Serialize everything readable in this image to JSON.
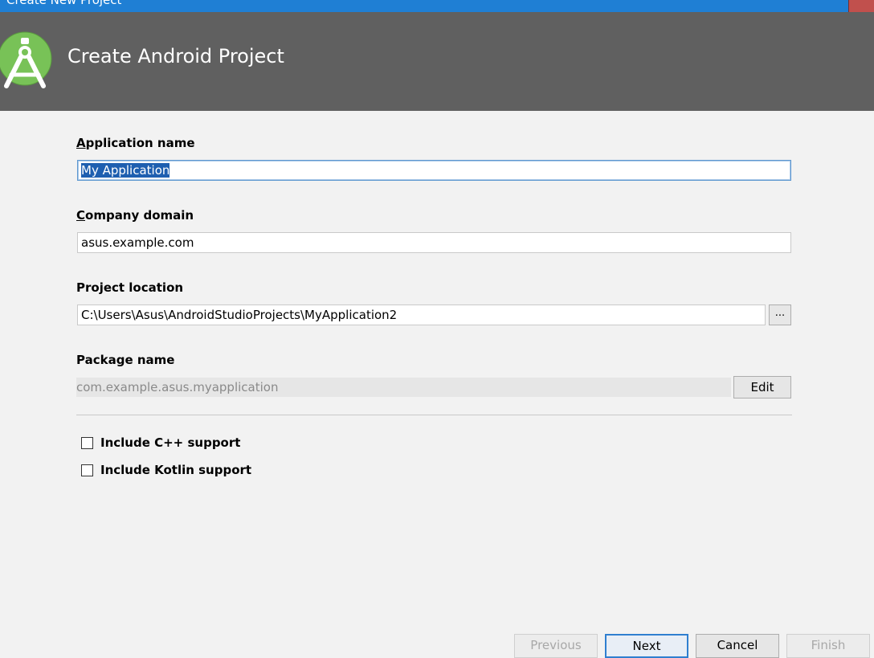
{
  "window": {
    "title": "Create New Project"
  },
  "header": {
    "title": "Create Android Project",
    "logo_icon": "android-studio-logo-icon"
  },
  "form": {
    "app_name": {
      "label_mnemonic": "A",
      "label_rest": "pplication name",
      "value": "My Application"
    },
    "company_domain": {
      "label_mnemonic": "C",
      "label_rest": "ompany domain",
      "value": "asus.example.com"
    },
    "project_location": {
      "label": "Project location",
      "value": "C:\\Users\\Asus\\AndroidStudioProjects\\MyApplication2",
      "browse_label": "..."
    },
    "package_name": {
      "label": "Package name",
      "value": "com.example.asus.myapplication",
      "edit_label": "Edit"
    },
    "include_cpp": {
      "label": "Include C++ support",
      "checked": false
    },
    "include_kotlin": {
      "label": "Include Kotlin support",
      "checked": false
    }
  },
  "footer": {
    "previous_label": "Previous",
    "next_label": "Next",
    "cancel_label": "Cancel",
    "finish_label": "Finish"
  },
  "colors": {
    "titlebar": "#1f7fd4",
    "header": "#606060",
    "body": "#f2f2f2",
    "logo_green": "#78c257",
    "selection": "#1e5fb0"
  }
}
